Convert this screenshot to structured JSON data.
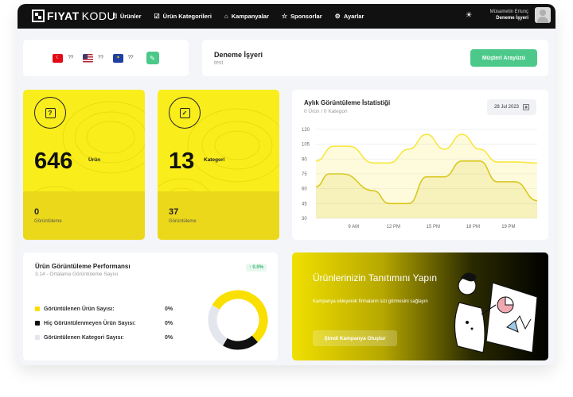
{
  "brand": {
    "part1": "FIYAT",
    "part2": "KODU"
  },
  "nav": {
    "items": [
      {
        "label": "Ürünler",
        "icon": "box-question-icon"
      },
      {
        "label": "Ürün Kategorileri",
        "icon": "checkbox-icon"
      },
      {
        "label": "Kampanyalar",
        "icon": "tag-icon"
      },
      {
        "label": "Sponsorlar",
        "icon": "star-icon"
      },
      {
        "label": "Ayarlar",
        "icon": "gear-icon"
      }
    ],
    "theme_icon": "sun-icon",
    "user_name": "Müsametin Ertunç",
    "user_company": "Deneme İşyeri"
  },
  "flags": [
    {
      "code": "tr",
      "value": "??"
    },
    {
      "code": "us",
      "value": "??"
    },
    {
      "code": "eu",
      "value": "??"
    }
  ],
  "company": {
    "name": "Deneme İşyeri",
    "subtitle": "test",
    "button": "Müşteri Arayüzü"
  },
  "stats": [
    {
      "value": "646",
      "label": "Ürün",
      "sub_value": "0",
      "sub_label": "Görüntüleme",
      "icon": "question-box-icon"
    },
    {
      "value": "13",
      "label": "Kategori",
      "sub_value": "37",
      "sub_label": "Görüntüleme",
      "icon": "check-box-icon"
    }
  ],
  "chart_card": {
    "title": "Aylık Görüntüleme İstatistiği",
    "subtitle": "0 Ürün / 0 Kategori",
    "date": "28 Jul 2023"
  },
  "chart_data": {
    "type": "area",
    "x_ticks": [
      "9 AM",
      "12 PM",
      "15 PM",
      "18 PM",
      "19 PM"
    ],
    "ylim": [
      30,
      120
    ],
    "y_ticks": [
      120,
      105,
      90,
      75,
      60,
      45,
      30
    ],
    "grid": true,
    "series": [
      {
        "x": [
          0,
          0.08,
          0.15,
          0.26,
          0.33,
          0.42,
          0.5,
          0.58,
          0.66,
          0.74,
          0.82,
          0.9,
          1.0
        ],
        "values": [
          88,
          103,
          103,
          86,
          86,
          100,
          115,
          100,
          115,
          100,
          87,
          87,
          86
        ]
      },
      {
        "x": [
          0,
          0.06,
          0.12,
          0.26,
          0.33,
          0.42,
          0.5,
          0.58,
          0.66,
          0.74,
          0.82,
          0.9,
          1.0
        ],
        "values": [
          62,
          75,
          75,
          58,
          45,
          45,
          72,
          72,
          88,
          88,
          67,
          67,
          48
        ]
      }
    ],
    "colors": [
      "#f7e740",
      "#d9c820"
    ]
  },
  "performance": {
    "title": "Ürün Görüntüleme Performansı",
    "subtitle": "3.14 - Ortalama Görüntüleme Sayısı",
    "badge": "↑ 0.0%",
    "rows": [
      {
        "label": "Görüntülenen Ürün Sayısı:",
        "value": "0%",
        "color": "#f9e000"
      },
      {
        "label": "Hiç Görüntülenmeyen Ürün Sayısı:",
        "value": "0%",
        "color": "#111111"
      },
      {
        "label": "Görüntülenen Kategori Sayısı:",
        "value": "0%",
        "color": "#e4e6ee"
      }
    ],
    "donut_shares": [
      0.55,
      0.2,
      0.25
    ]
  },
  "promo": {
    "title": "Ürünlerinizin Tanıtımını Yapın",
    "description": "Kampanya ekleyerek firmaların sizi görmesini sağlayın",
    "button": "Şimdi Kampanya Oluştur"
  }
}
